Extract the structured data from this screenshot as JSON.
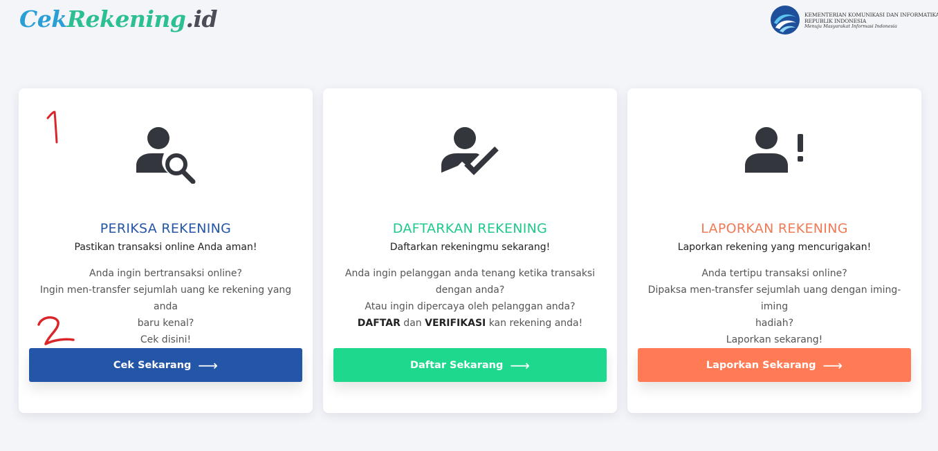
{
  "header": {
    "logo": {
      "part1": "Cek",
      "part2": "Rekening",
      "part3": ".id"
    },
    "kominfo": {
      "line1": "KEMENTERIAN KOMUNIKASI DAN INFORMATIKA",
      "line2": "REPUBLIK INDONESIA",
      "tagline": "Menuju Masyarakat Informasi Indonesia"
    }
  },
  "cards": [
    {
      "icon": "user-search-icon",
      "title": "PERIKSA REKENING",
      "subtitle": "Pastikan transaksi online Anda aman!",
      "lines": [
        "Anda ingin bertransaksi online?",
        "Ingin men-transfer sejumlah uang ke rekening yang anda",
        "baru kenal?",
        "Cek disini!"
      ],
      "button": "Cek Sekarang",
      "color": "#2456a8"
    },
    {
      "icon": "user-check-icon",
      "title": "DAFTARKAN REKENING",
      "subtitle": "Daftarkan rekeningmu sekarang!",
      "lines": [
        "Anda ingin pelanggan anda tenang ketika transaksi",
        "dengan anda?",
        "Atau ingin dipercaya oleh pelanggan anda?"
      ],
      "line4": {
        "b1": "DAFTAR",
        "t1": " dan ",
        "b2": "VERIFIKASI",
        "t2": " kan rekening anda!"
      },
      "button": "Daftar Sekarang",
      "color": "#1ed98d"
    },
    {
      "icon": "user-alert-icon",
      "title": "LAPORKAN REKENING",
      "subtitle": "Laporkan rekening yang mencurigakan!",
      "lines": [
        "Anda tertipu transaksi online?",
        "Dipaksa men-transfer sejumlah uang dengan iming-iming",
        "hadiah?",
        "Laporkan sekarang!"
      ],
      "button": "Laporkan Sekarang",
      "color": "#ff7b55"
    }
  ],
  "annotations": {
    "one": "1",
    "two": "2"
  }
}
